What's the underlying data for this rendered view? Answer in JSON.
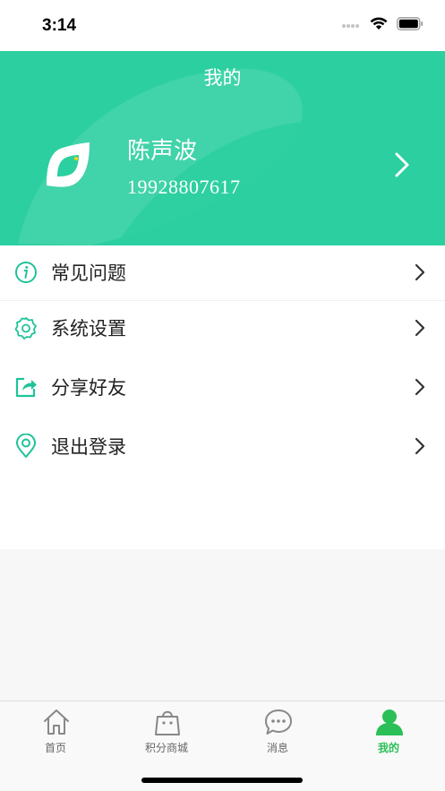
{
  "status_bar": {
    "time": "3:14"
  },
  "header": {
    "title": "我的",
    "user_name": "陈声波",
    "user_phone": "19928807617"
  },
  "menu": [
    {
      "label": "常见问题",
      "icon": "info-icon"
    },
    {
      "label": "系统设置",
      "icon": "gear-icon"
    },
    {
      "label": "分享好友",
      "icon": "share-icon"
    },
    {
      "label": "退出登录",
      "icon": "location-pin-icon"
    }
  ],
  "tabs": [
    {
      "label": "首页",
      "icon": "home-icon",
      "active": false
    },
    {
      "label": "积分商城",
      "icon": "shopping-bag-icon",
      "active": false
    },
    {
      "label": "消息",
      "icon": "chat-bubble-icon",
      "active": false
    },
    {
      "label": "我的",
      "icon": "user-icon",
      "active": true
    }
  ],
  "colors": {
    "accent": "#2ccfa0",
    "icon_teal": "#1fc39a",
    "tab_active": "#2bbf57",
    "tab_inactive": "#888888"
  }
}
